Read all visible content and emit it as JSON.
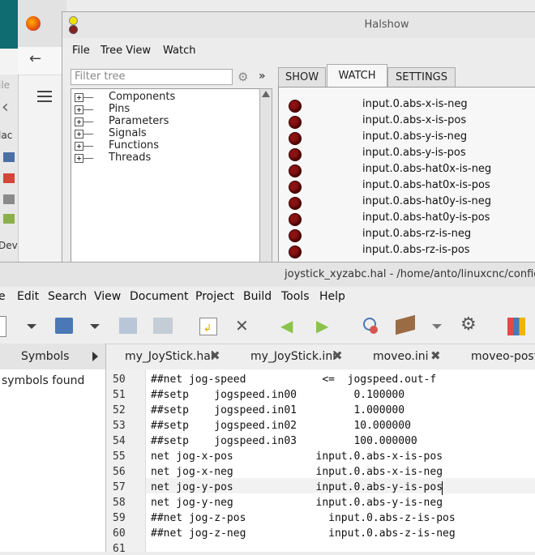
{
  "background": {
    "left_labels": [
      "ile",
      "lac",
      "Dev"
    ]
  },
  "halshow": {
    "title": "Halshow",
    "menu": [
      "File",
      "Tree View",
      "Watch"
    ],
    "filter_placeholder": "Filter tree",
    "expand_symbol": "»",
    "tree": [
      "Components",
      "Pins",
      "Parameters",
      "Signals",
      "Functions",
      "Threads"
    ],
    "tabs": [
      "SHOW",
      "WATCH",
      "SETTINGS"
    ],
    "active_tab": "WATCH",
    "watch": [
      "input.0.abs-x-is-neg",
      "input.0.abs-x-is-pos",
      "input.0.abs-y-is-neg",
      "input.0.abs-y-is-pos",
      "input.0.abs-hat0x-is-neg",
      "input.0.abs-hat0x-is-pos",
      "input.0.abs-hat0y-is-neg",
      "input.0.abs-hat0y-is-pos",
      "input.0.abs-rz-is-neg",
      "input.0.abs-rz-is-pos"
    ],
    "led_color": "#8b1212"
  },
  "geany": {
    "title": "joystick_xyzabc.hal - /home/anto/linuxcnc/configs/s",
    "menu": [
      "e",
      "Edit",
      "Search",
      "View",
      "Document",
      "Project",
      "Build",
      "Tools",
      "Help"
    ],
    "sidebar_tab": "Symbols",
    "sidebar_text": "symbols found",
    "tabs": [
      "my_JoyStick.hal",
      "my_JoyStick.ini",
      "moveo.ini",
      "moveo-postg"
    ],
    "lines": [
      {
        "n": "50",
        "code": "##net jog-speed            <=  jogspeed.out-f"
      },
      {
        "n": "51",
        "code": "##setp    jogspeed.in00         0.100000"
      },
      {
        "n": "52",
        "code": "##setp    jogspeed.in01         1.000000"
      },
      {
        "n": "53",
        "code": "##setp    jogspeed.in02         10.000000"
      },
      {
        "n": "54",
        "code": "##setp    jogspeed.in03         100.000000"
      },
      {
        "n": "55",
        "code": "net jog-x-pos             input.0.abs-x-is-pos"
      },
      {
        "n": "56",
        "code": "net jog-x-neg             input.0.abs-x-is-neg"
      },
      {
        "n": "57",
        "code": "net jog-y-pos             input.0.abs-y-is-pos"
      },
      {
        "n": "58",
        "code": "net jog-y-neg             input.0.abs-y-is-neg"
      },
      {
        "n": "59",
        "code": "##net jog-z-pos             input.0.abs-z-is-pos"
      },
      {
        "n": "60",
        "code": "##net jog-z-neg             input.0.abs-z-is-neg"
      },
      {
        "n": "61",
        "code": ""
      }
    ]
  }
}
